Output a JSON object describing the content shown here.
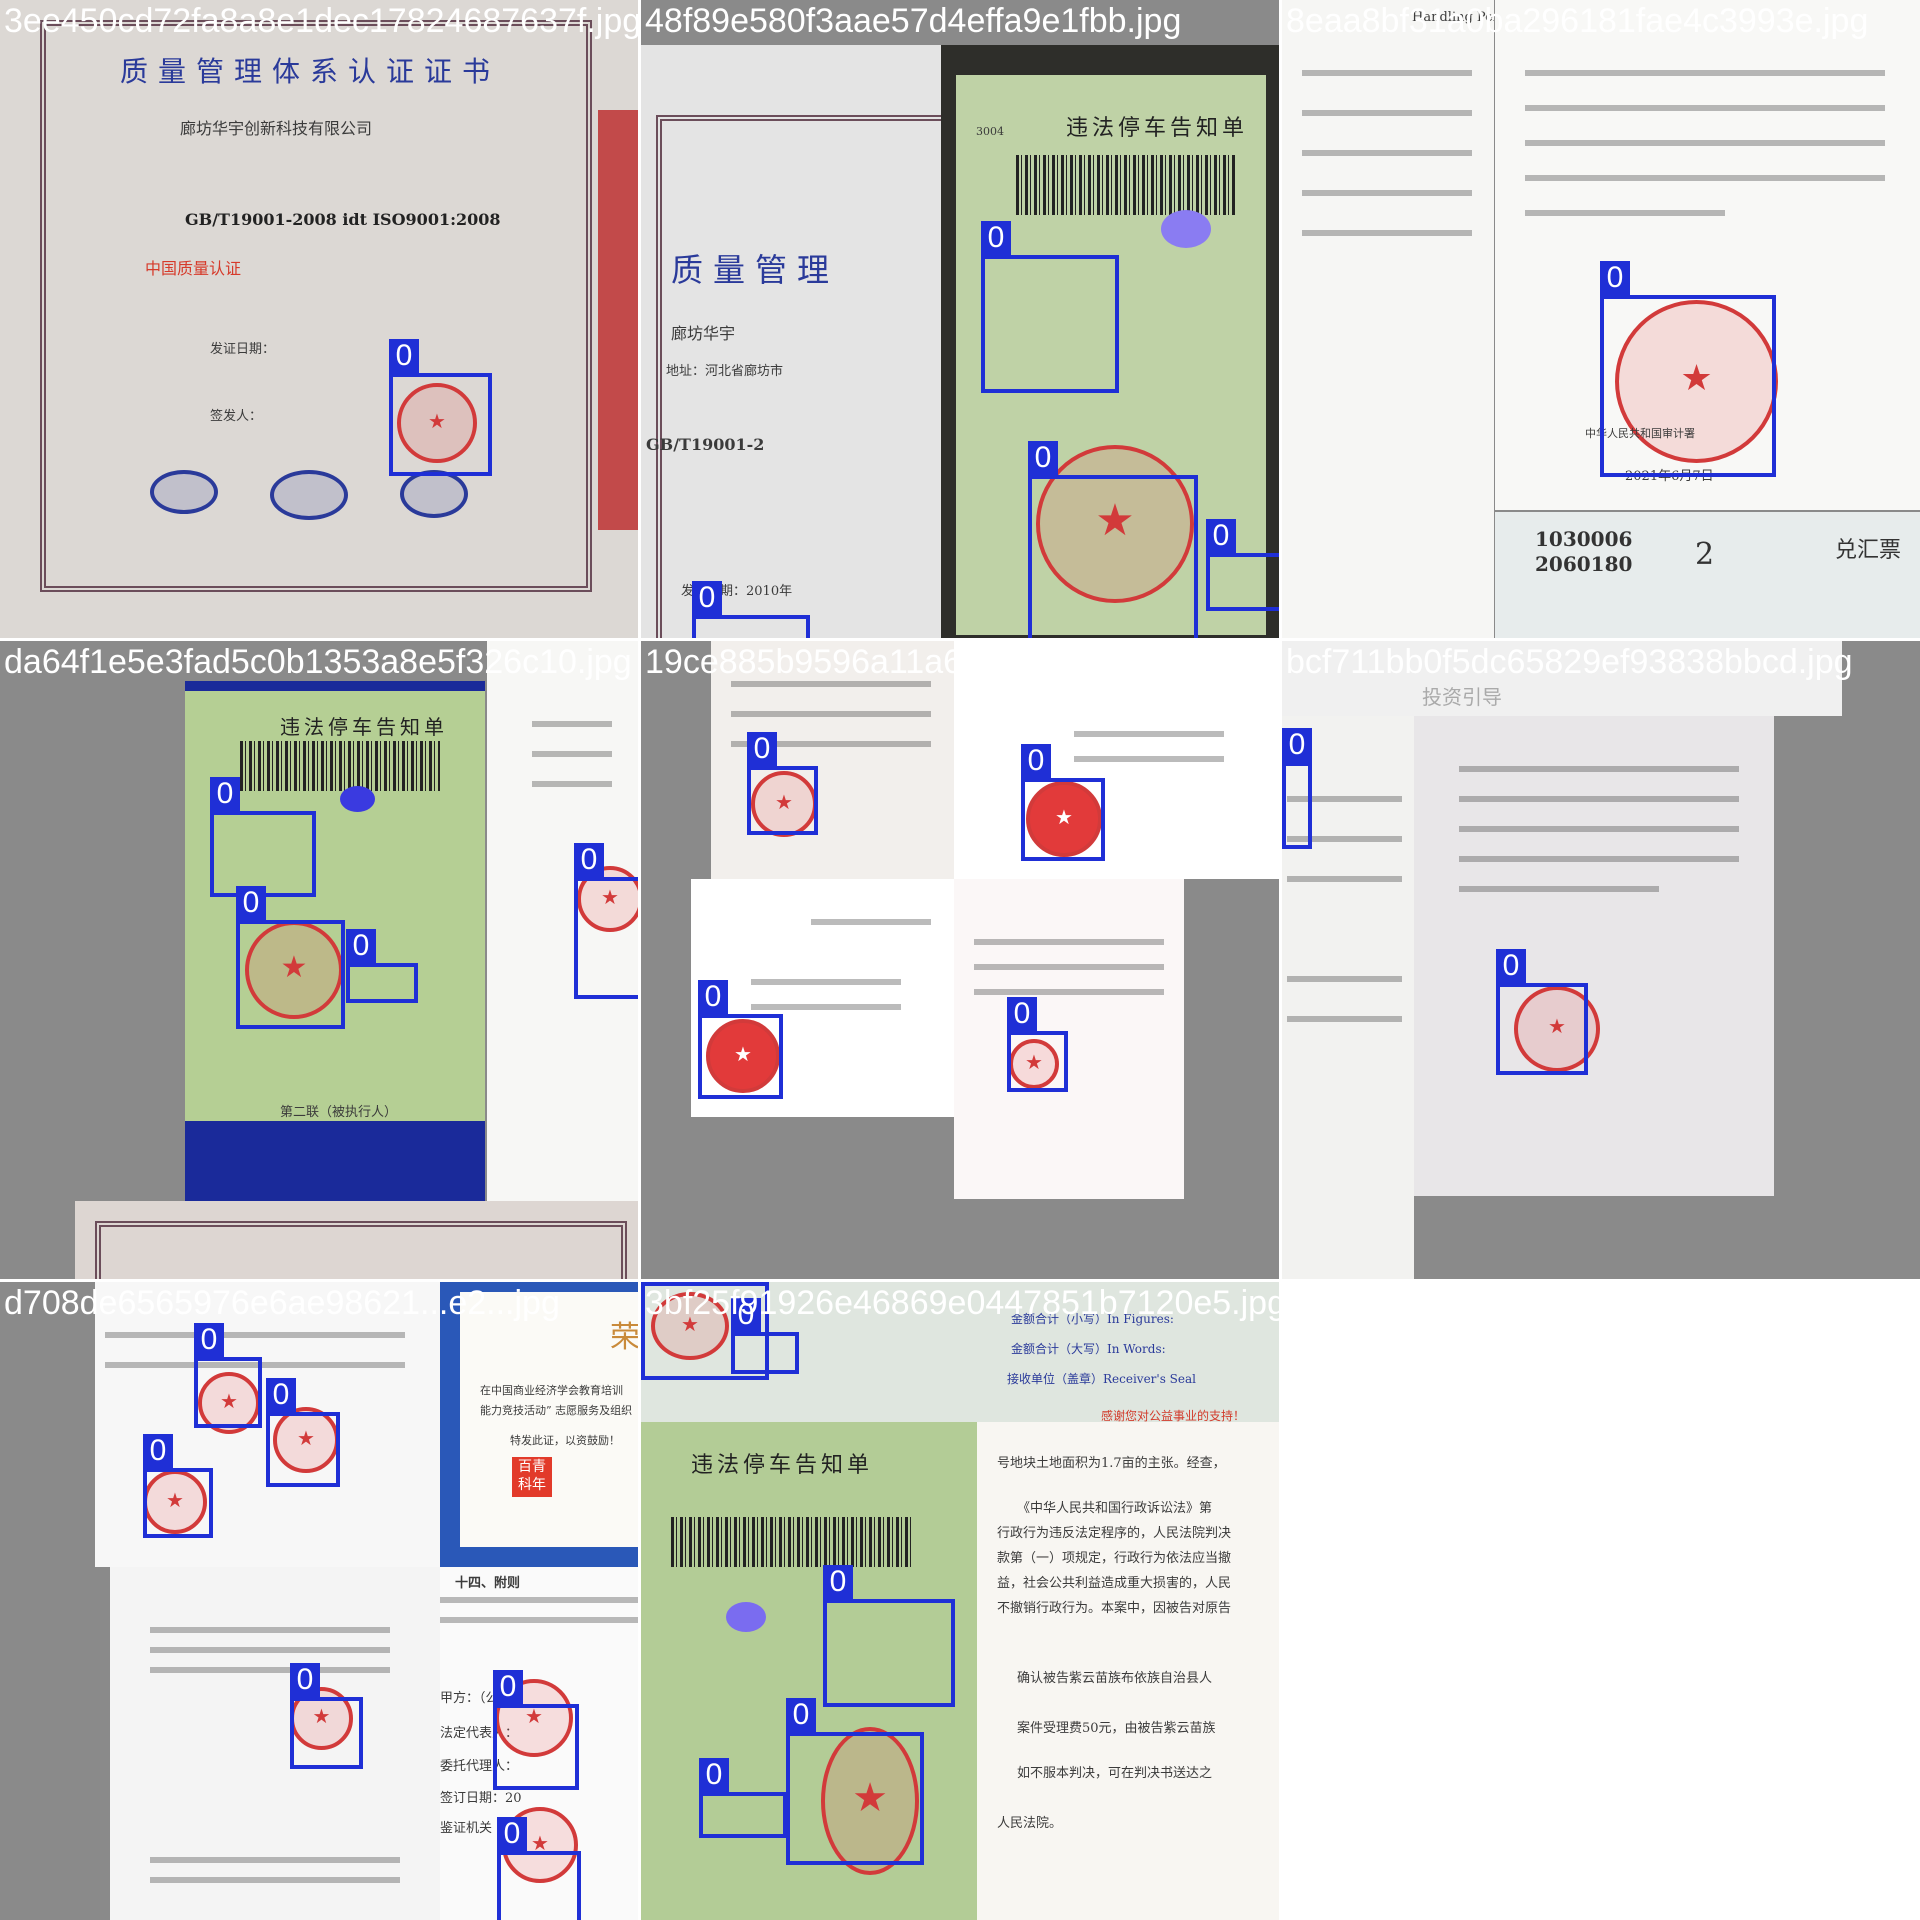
{
  "mosaic": {
    "label_color": "#1f2fd6",
    "filename_color": "#ffffff",
    "class_label": "0",
    "cells": [
      {
        "filename": "3ee450cd72fa8a8e1dec17824687637f.jpg",
        "texts": [
          "质量管理体系认证证书",
          "廊坊华宇创新科技有限公司",
          "GB/T19001-2008 idt ISO9001:2008",
          "中国质量认证",
          "发证日期：",
          "签发人："
        ]
      },
      {
        "filename": "48f89e580f3aae57d4effa9e1fbb.jpg",
        "texts": [
          "质量管理",
          "廊坊华宇",
          "地址：河北省廊坊市",
          "GB/T19001-2",
          "违法停车告知单",
          "3004",
          "发证日期：2010年"
        ]
      },
      {
        "filename": "8eaa8bf31a0ba296181fae4c3993e.jpg",
        "texts": [
          "Handling Person",
          "中华人民共和国审计署",
          "2021年6月7日",
          "兑汇票",
          "1030006",
          "2060180",
          "2"
        ]
      },
      {
        "filename": "da64f1e5e3fad5c0b1353a8e5f326c10.jpg",
        "texts": [
          "违法停车告知单",
          "第二联（被执行人）"
        ]
      },
      {
        "filename": "19ce885b9596a11a6bb4b5a31bd3f6.jpg",
        "texts": []
      },
      {
        "filename": "bcf711bb0f5dc65829ef93838bbcd.jpg",
        "texts": [
          "投资引导"
        ]
      },
      {
        "filename": "d708de6565976e6ae98621...e2...jpg",
        "texts": [
          "荣",
          "在中国商业经济学会教育培训",
          "能力竞技活动” 志愿服务及组织",
          "特发此证，以资鼓励！",
          "百青科年",
          "十四、附则",
          "甲方：（公",
          "法定代表人：",
          "委托代理人：",
          "签订日期：20",
          "鉴证机关（盖"
        ]
      },
      {
        "filename": "3bf25f91926e46869e0447851b7120e5.jpg",
        "texts": [
          "金额合计（小写）In Figures:",
          "金额合计（大写）In Words:",
          "接收单位（盖章）Receiver's Seal",
          "感谢您对公益事业的支持！",
          "违法停车告知单",
          "号地块土地面积为1.7亩的主张。经查，",
          "《中华人民共和国行政诉讼法》第",
          "行政行为违反法定程序的，人民法院判决",
          "款第（一）项规定，行政行为依法应当撤",
          "益，社会公共利益造成重大损害的，人民",
          "不撤销行政行为。本案中，因被告对原告",
          "确认被告紫云苗族布依族自治县人",
          "案件受理费50元，由被告紫云苗族",
          "如不服本判决，可在判决书送达之",
          "人民法院。"
        ]
      }
    ]
  }
}
